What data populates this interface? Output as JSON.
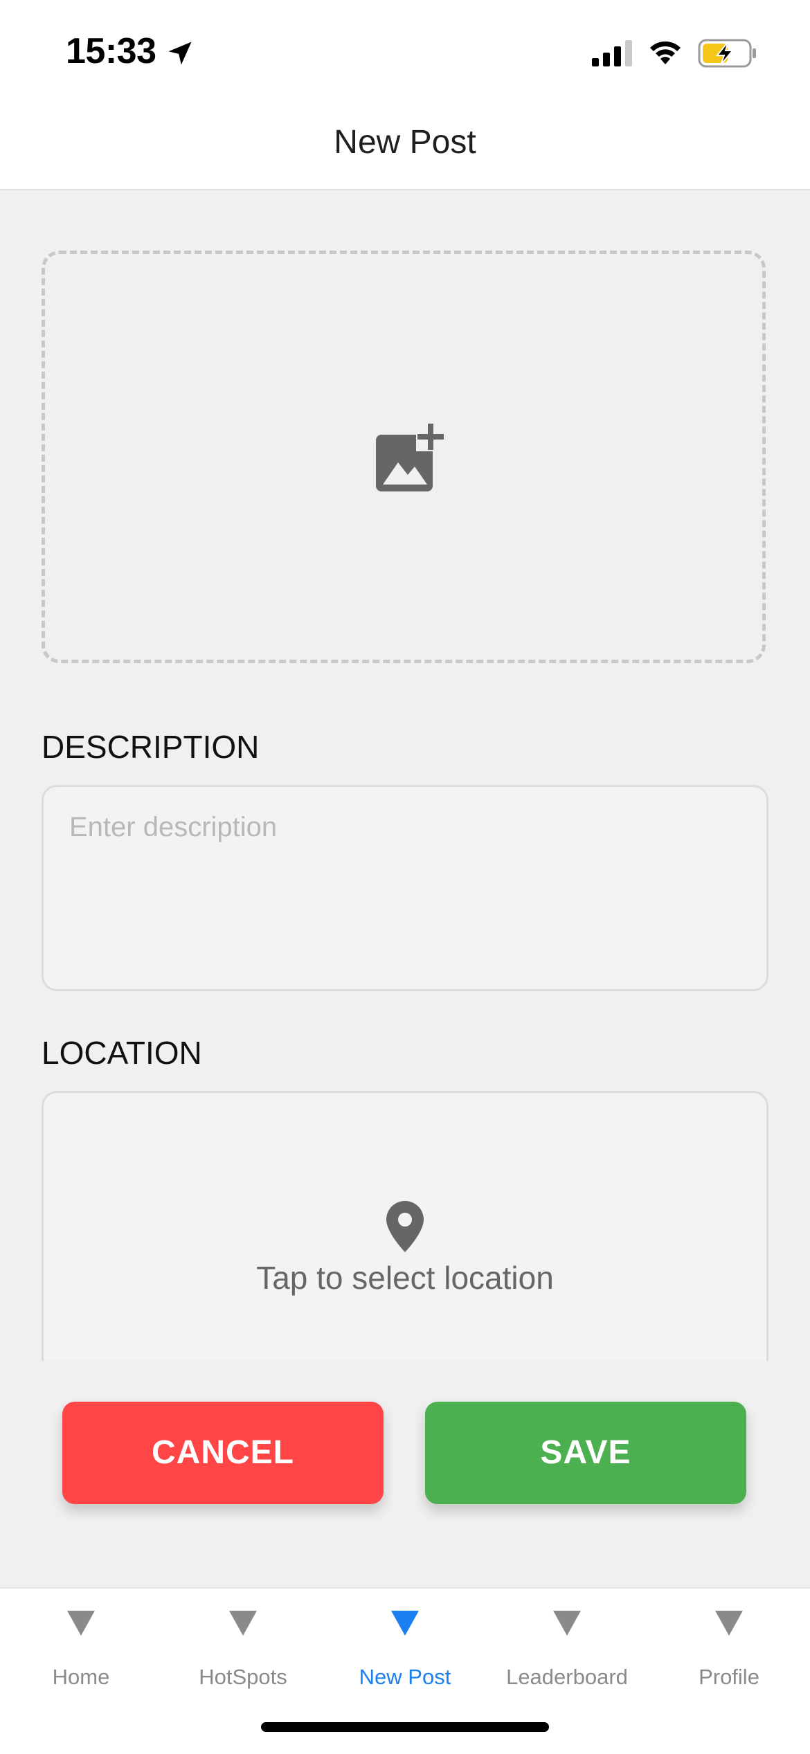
{
  "status": {
    "time": "15:33",
    "icons": [
      "location-arrow-icon",
      "cellular-signal-icon",
      "wifi-icon",
      "battery-charging-icon"
    ]
  },
  "header": {
    "title": "New Post"
  },
  "image_picker": {
    "icon": "add-photo-icon"
  },
  "description": {
    "label": "DESCRIPTION",
    "placeholder": "Enter description",
    "value": ""
  },
  "location": {
    "label": "LOCATION",
    "icon": "map-pin-icon",
    "prompt": "Tap to select location"
  },
  "actions": {
    "cancel_label": "CANCEL",
    "save_label": "SAVE"
  },
  "tabs": [
    {
      "label": "Home",
      "icon": "triangle-down-icon",
      "active": false
    },
    {
      "label": "HotSpots",
      "icon": "triangle-down-icon",
      "active": false
    },
    {
      "label": "New Post",
      "icon": "triangle-down-icon",
      "active": true
    },
    {
      "label": "Leaderboard",
      "icon": "triangle-down-icon",
      "active": false
    },
    {
      "label": "Profile",
      "icon": "triangle-down-icon",
      "active": false
    }
  ],
  "colors": {
    "cancel": "#ff4545",
    "save": "#4caf50",
    "active_tab": "#1a7ff0",
    "inactive_tab": "#8a8a8a",
    "background": "#f0f0f0"
  }
}
